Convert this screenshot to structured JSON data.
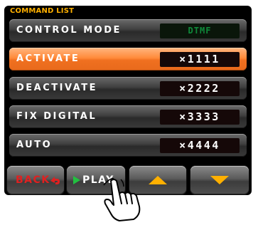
{
  "header": {
    "title": "COMMAND LIST"
  },
  "rows": [
    {
      "label": "CONTROL MODE",
      "value": "DTMF"
    },
    {
      "label": "ACTIVATE",
      "value": "×1111"
    },
    {
      "label": "DEACTIVATE",
      "value": "×2222"
    },
    {
      "label": "FIX DIGITAL",
      "value": "×3333"
    },
    {
      "label": "AUTO",
      "value": "×4444"
    }
  ],
  "softkeys": {
    "back": "BACK",
    "play": "PLAY",
    "up": "up-arrow-icon",
    "down": "down-arrow-icon"
  },
  "colors": {
    "title": "#ffb000",
    "selected_row": "#ff8a3a",
    "back_text": "#e02020",
    "play_text": "#ffffff",
    "play_icon": "#22c040",
    "arrow": "#ffb000"
  }
}
